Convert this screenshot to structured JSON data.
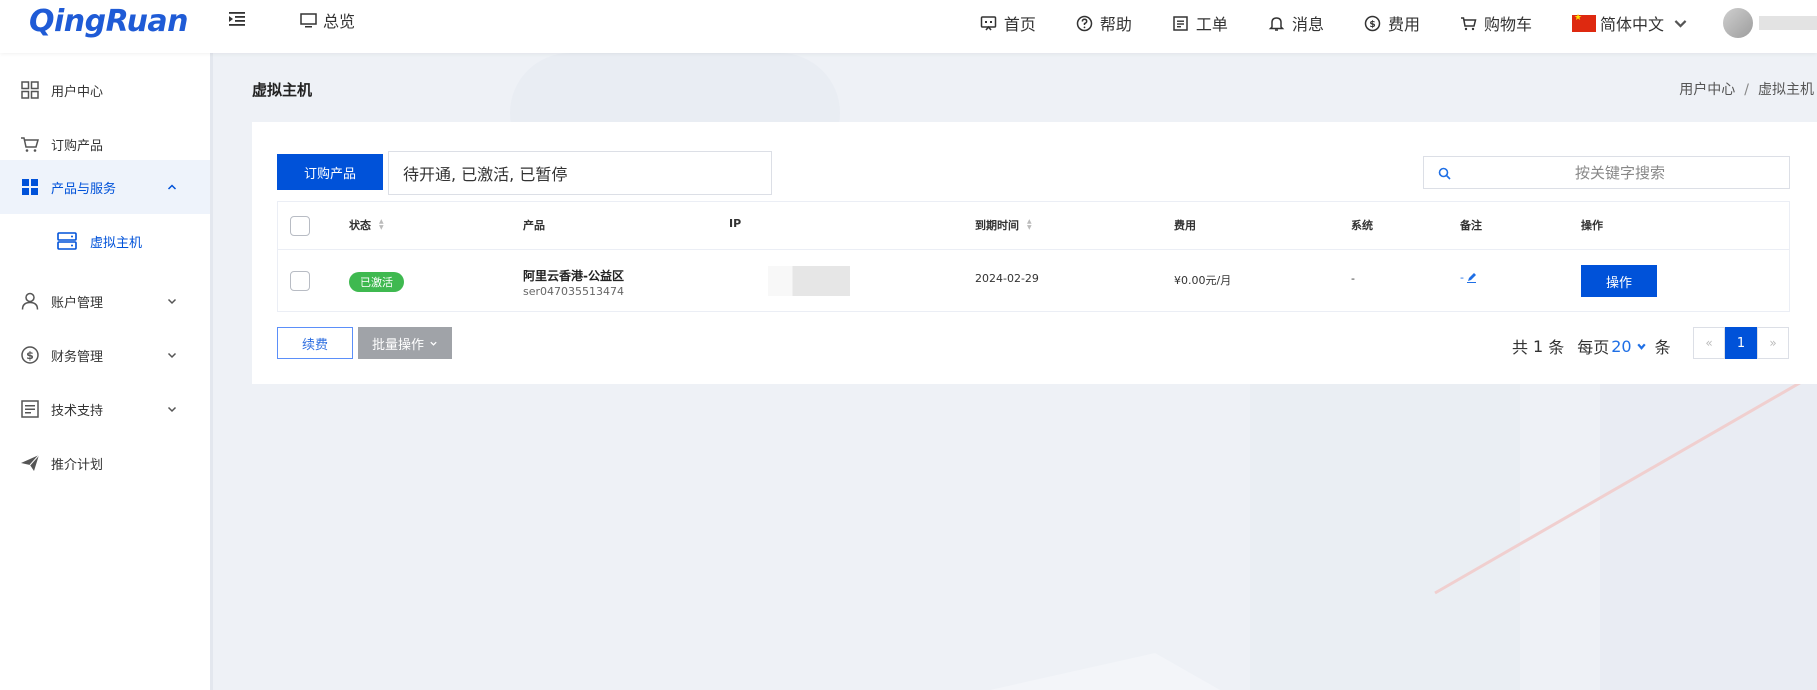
{
  "brand": {
    "logo": "QingRuan"
  },
  "header": {
    "overview": "总览",
    "nav": [
      {
        "label": "首页",
        "icon": "home-icon"
      },
      {
        "label": "帮助",
        "icon": "help-icon"
      },
      {
        "label": "工单",
        "icon": "ticket-icon"
      },
      {
        "label": "消息",
        "icon": "bell-icon"
      },
      {
        "label": "费用",
        "icon": "dollar-icon"
      },
      {
        "label": "购物车",
        "icon": "cart-icon"
      }
    ],
    "language": "简体中文"
  },
  "sidebar": {
    "items": [
      {
        "label": "用户中心",
        "icon": "grid-icon"
      },
      {
        "label": "订购产品",
        "icon": "cart-icon"
      },
      {
        "label": "产品与服务",
        "icon": "apps-icon"
      },
      {
        "label": "虚拟主机",
        "icon": "server-icon"
      },
      {
        "label": "账户管理",
        "icon": "user-icon"
      },
      {
        "label": "财务管理",
        "icon": "dollar-icon"
      },
      {
        "label": "技术支持",
        "icon": "document-icon"
      },
      {
        "label": "推介计划",
        "icon": "paper-plane-icon"
      }
    ]
  },
  "page": {
    "title": "虚拟主机",
    "breadcrumb": [
      "用户中心",
      "虚拟主机"
    ]
  },
  "toolbar": {
    "order_label": "订购产品",
    "status_filter": "待开通, 已激活, 已暂停",
    "search_placeholder": "按关键字搜索"
  },
  "table": {
    "columns": [
      "状态",
      "产品",
      "IP",
      "到期时间",
      "费用",
      "系统",
      "备注",
      "操作"
    ],
    "rows": [
      {
        "status": "已激活",
        "product_name": "阿里云香港-公益区",
        "product_id": "ser047035513474",
        "expiry": "2024-02-29",
        "fee": "¥0.00元/月",
        "system": "-",
        "note": "-",
        "action": "操作"
      }
    ]
  },
  "footer": {
    "renew_label": "续费",
    "batch_label": "批量操作",
    "total_prefix": "共",
    "total_count": "1",
    "total_suffix": "条",
    "per_page_prefix": "每页",
    "per_page": "20",
    "per_page_suffix": "条",
    "prev": "«",
    "current_page": "1",
    "next": "»"
  },
  "colors": {
    "primary": "#0052d9",
    "success": "#3fb950",
    "disabled": "#a0a3a8"
  }
}
